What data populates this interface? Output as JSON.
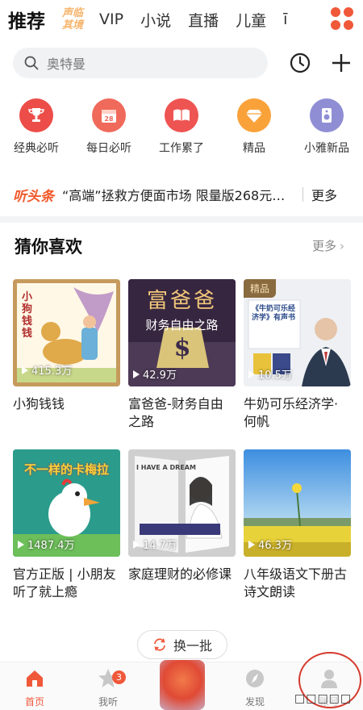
{
  "tabs": [
    {
      "label": "推荐",
      "active": true
    },
    {
      "label": "VIP"
    },
    {
      "label": "小说"
    },
    {
      "label": "直播"
    },
    {
      "label": "儿童"
    },
    {
      "label": "ī"
    }
  ],
  "special_tab": {
    "line1": "声临",
    "line2": "其境"
  },
  "search": {
    "placeholder": "奥特曼"
  },
  "entries": [
    {
      "label": "经典必听",
      "color": "#ec4d48"
    },
    {
      "label": "每日必听",
      "color": "#f06a5b"
    },
    {
      "label": "工作累了",
      "color": "#ee5451"
    },
    {
      "label": "精品",
      "color": "#f9a23a"
    },
    {
      "label": "小雅新品",
      "color": "#8f8ed4"
    }
  ],
  "headline": {
    "tag": "听头条",
    "text": "“高端”拯救方便面市场 限量版268元…",
    "more": "更多"
  },
  "section": {
    "title": "猜你喜欢",
    "more": "更多"
  },
  "cards": [
    {
      "title": "小狗钱钱",
      "plays": "415.3万",
      "cover_text": "小狗钱钱"
    },
    {
      "title": "富爸爸-财务自由之路",
      "plays": "42.9万",
      "cover_text": "富爸爸",
      "cover_sub": "财务自由之路"
    },
    {
      "title": "牛奶可乐经济学·何帆",
      "plays": "10.5万",
      "badge": "精品",
      "cover_text": "《牛奶可乐经济学》有声书"
    },
    {
      "title": "官方正版 | 小朋友听了就上瘾",
      "plays": "1487.4万",
      "cover_text": "不一样的卡梅拉"
    },
    {
      "title": "家庭理财的必修课",
      "plays": "14.7万",
      "cover_text": "I HAVE A DREAM"
    },
    {
      "title": "八年级语文下册古诗文朗读",
      "plays": "46.3万"
    }
  ],
  "refresh": {
    "label": "换一批"
  },
  "bottom_nav": [
    {
      "label": "首页",
      "active": true
    },
    {
      "label": "我听",
      "badge": "3"
    },
    {
      "label": "发现"
    },
    {
      "label": "账号"
    }
  ],
  "watermark": "□□□□□",
  "colors": {
    "accent": "#f0583a"
  }
}
